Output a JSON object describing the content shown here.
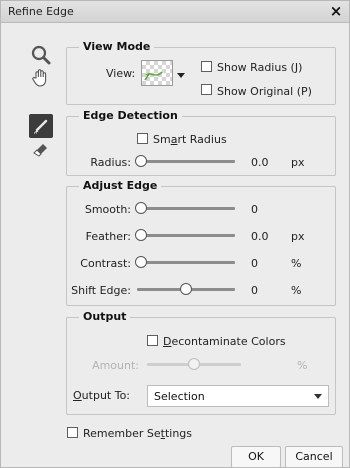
{
  "dialog": {
    "title": "Refine Edge",
    "close_glyph": "×"
  },
  "tools": [
    {
      "icon": "zoom-icon"
    },
    {
      "icon": "hand-icon"
    },
    {
      "icon": "refine-radius-brush-icon",
      "selected": true
    },
    {
      "icon": "erase-refinements-icon"
    }
  ],
  "view_mode": {
    "legend": "View Mode",
    "view_label": "View:",
    "show_radius_label": "Show Radius (J)",
    "show_radius_checked": false,
    "show_original_label": "Show Original (P)",
    "show_original_checked": false
  },
  "edge_detection": {
    "legend": "Edge Detection",
    "smart_radius_pre": "Sm",
    "smart_radius_ul": "a",
    "smart_radius_post": "rt Radius",
    "smart_radius_checked": false,
    "radius": {
      "label": "Radius:",
      "value": "0.0",
      "unit": "px",
      "level": 0
    }
  },
  "adjust_edge": {
    "legend": "Adjust Edge",
    "smooth": {
      "label": "Smooth:",
      "value": "0",
      "unit": "",
      "level": 0
    },
    "feather": {
      "label": "Feather:",
      "value": "0.0",
      "unit": "px",
      "level": 0
    },
    "contrast": {
      "label": "Contrast:",
      "value": "0",
      "unit": "%",
      "level": 0
    },
    "shift_edge": {
      "label": "Shift Edge:",
      "value": "0",
      "unit": "%",
      "level": 0.5
    }
  },
  "output": {
    "legend": "Output",
    "decontaminate_ul": "D",
    "decontaminate_post": "econtaminate Colors",
    "decontaminate_checked": false,
    "amount": {
      "label": "Amount:",
      "unit": "%",
      "level": 0.5,
      "enabled": false
    },
    "output_to_ul": "O",
    "output_to_post": "utput To:",
    "output_to_value": "Selection"
  },
  "remember": {
    "pre": "Remember Se",
    "ul": "t",
    "post": "tings",
    "checked": false
  },
  "buttons": {
    "ok": "OK",
    "cancel": "Cancel"
  },
  "colors": {
    "panel": "#ececec",
    "brush_tool_bg": "#3c3c3c",
    "accent_green": "#5fae3b"
  }
}
